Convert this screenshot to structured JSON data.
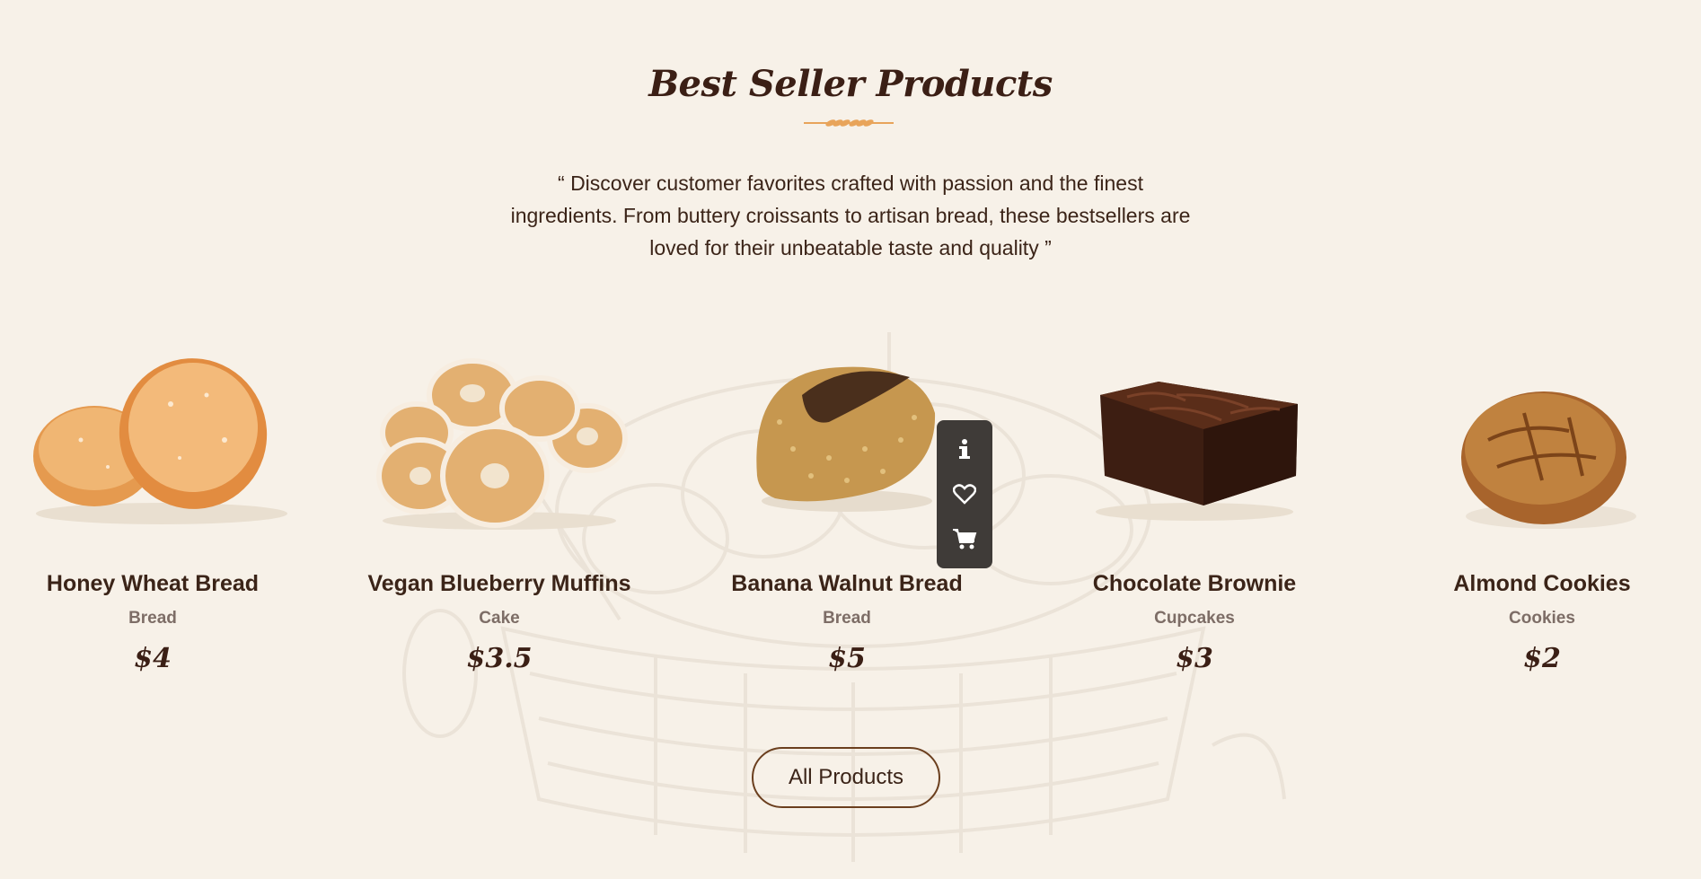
{
  "section": {
    "title": "Best Seller Products",
    "description": "“ Discover customer favorites crafted with passion and the finest ingredients. From buttery croissants to artisan bread, these bestsellers are loved for their unbeatable taste and quality ”"
  },
  "products": [
    {
      "name": "Honey Wheat Bread",
      "category": "Bread",
      "price": "$4",
      "image": "donuts-icon"
    },
    {
      "name": "Vegan Blueberry Muffins",
      "category": "Cake",
      "price": "$3.5",
      "image": "pastry-rings-icon"
    },
    {
      "name": "Banana Walnut Bread",
      "category": "Bread",
      "price": "$5",
      "image": "loaf-icon"
    },
    {
      "name": "Chocolate Brownie",
      "category": "Cupcakes",
      "price": "$3",
      "image": "brownie-icon"
    },
    {
      "name": "Almond Cookies",
      "category": "Cookies",
      "price": "$2",
      "image": "round-bread-icon"
    }
  ],
  "actions": [
    "info-icon",
    "heart-icon",
    "cart-icon"
  ],
  "cta": {
    "label": "All Products"
  },
  "colors": {
    "background": "#f7f1e8",
    "title": "#3b1f15",
    "accent": "#e8a45a",
    "panel": "#3f3b38",
    "button_border": "#6b3f1e"
  }
}
